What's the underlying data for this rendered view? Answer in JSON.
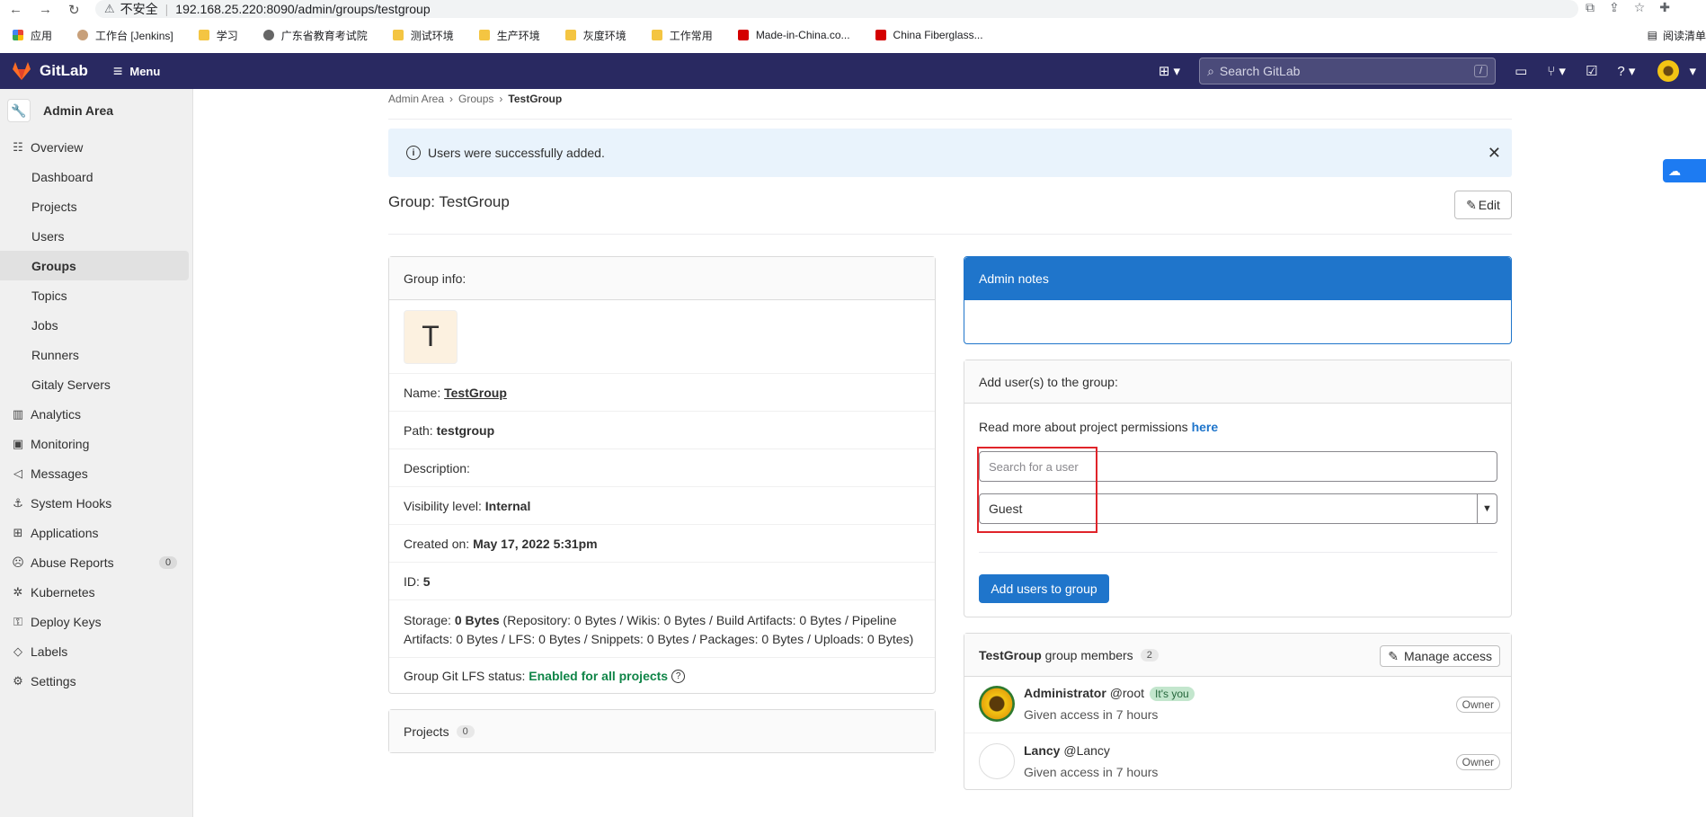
{
  "browser": {
    "security_label": "不安全",
    "url": "192.168.25.220:8090/admin/groups/testgroup",
    "bookmarks": [
      "应用",
      "工作台 [Jenkins]",
      "学习",
      "广东省教育考试院",
      "测试环境",
      "生产环境",
      "灰度环境",
      "工作常用",
      "Made-in-China.co...",
      "China Fiberglass..."
    ],
    "reading_list": "阅读清单"
  },
  "header": {
    "brand": "GitLab",
    "menu_label": "Menu",
    "search_placeholder": "Search GitLab",
    "search_shortcut": "/"
  },
  "sidebar": {
    "title": "Admin Area",
    "overview": "Overview",
    "sub_items": [
      "Dashboard",
      "Projects",
      "Users",
      "Groups",
      "Topics",
      "Jobs",
      "Runners",
      "Gitaly Servers"
    ],
    "items": [
      "Analytics",
      "Monitoring",
      "Messages",
      "System Hooks",
      "Applications",
      "Abuse Reports",
      "Kubernetes",
      "Deploy Keys",
      "Labels",
      "Settings"
    ],
    "abuse_count": "0"
  },
  "breadcrumb": [
    "Admin Area",
    "Groups",
    "TestGroup"
  ],
  "alert": {
    "message": "Users were successfully added."
  },
  "page": {
    "title": "Group: TestGroup",
    "edit_label": "Edit"
  },
  "group_info": {
    "header": "Group info:",
    "avatar_letter": "T",
    "name_label": "Name:",
    "name_value": "TestGroup",
    "path_label": "Path:",
    "path_value": "testgroup",
    "description_label": "Description:",
    "visibility_label": "Visibility level:",
    "visibility_value": "Internal",
    "created_label": "Created on:",
    "created_value": "May 17, 2022 5:31pm",
    "id_label": "ID:",
    "id_value": "5",
    "storage_label": "Storage:",
    "storage_value": "0 Bytes",
    "storage_detail_1": "(Repository: 0 Bytes / Wikis: 0 Bytes / Build Artifacts: 0 Bytes / Pipeline",
    "storage_detail_2": "Artifacts: 0 Bytes / LFS: 0 Bytes / Snippets: 0 Bytes / Packages: 0 Bytes / Uploads: 0 Bytes)",
    "lfs_label": "Group Git LFS status:",
    "lfs_value": "Enabled for all projects"
  },
  "projects": {
    "label": "Projects",
    "count": "0"
  },
  "admin_notes": {
    "header": "Admin notes"
  },
  "add_users": {
    "header": "Add user(s) to the group:",
    "read_more": "Read more about project permissions",
    "here": "here",
    "search_placeholder": "Search for a user",
    "role": "Guest",
    "button": "Add users to group"
  },
  "members": {
    "group": "TestGroup",
    "suffix": "group members",
    "count": "2",
    "manage": "Manage access",
    "list": [
      {
        "name": "Administrator",
        "handle": "@root",
        "badge": "It's you",
        "since": "Given access in 7 hours",
        "role": "Owner"
      },
      {
        "name": "Lancy",
        "handle": "@Lancy",
        "since": "Given access in 7 hours",
        "role": "Owner"
      }
    ]
  },
  "colors": {
    "header": "#292961",
    "primary": "#1f75cb",
    "success": "#108548"
  }
}
